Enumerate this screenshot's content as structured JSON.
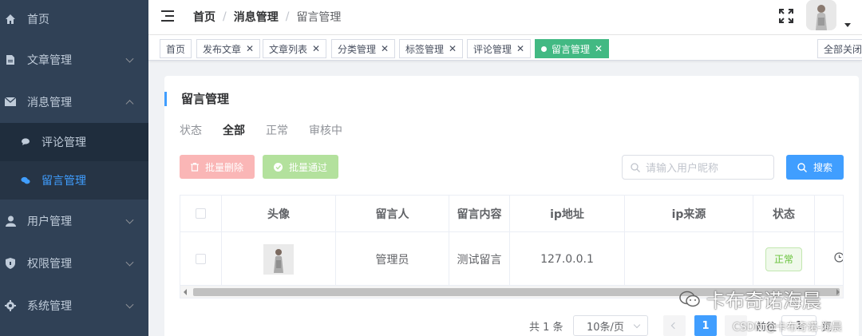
{
  "sidebar": {
    "items": [
      {
        "label": "首页",
        "icon": "home-icon"
      },
      {
        "label": "文章管理",
        "icon": "document-icon"
      },
      {
        "label": "消息管理",
        "icon": "mail-icon"
      },
      {
        "label": "评论管理",
        "icon": "comment-icon"
      },
      {
        "label": "留言管理",
        "icon": "chat-icon"
      },
      {
        "label": "用户管理",
        "icon": "user-icon"
      },
      {
        "label": "权限管理",
        "icon": "shield-icon"
      },
      {
        "label": "系统管理",
        "icon": "gear-icon"
      }
    ],
    "active_color": "#409eff",
    "bg_color": "#304156"
  },
  "header": {
    "breadcrumb": [
      "首页",
      "消息管理",
      "留言管理"
    ],
    "separator": "/"
  },
  "tags": {
    "items": [
      "首页",
      "发布文章",
      "文章列表",
      "分类管理",
      "标签管理",
      "评论管理",
      "留言管理"
    ],
    "active": "留言管理",
    "close_all": "全部关闭",
    "close_glyph": "✕",
    "active_color": "#42b983"
  },
  "page": {
    "title": "留言管理",
    "status_label": "状态",
    "status_options": [
      "全部",
      "正常",
      "审核中"
    ],
    "selected_status": "全部"
  },
  "toolbar": {
    "batch_delete": "批量删除",
    "batch_pass": "批量通过",
    "search_placeholder": "请输入用户昵称",
    "search_button": "搜索"
  },
  "table": {
    "columns": [
      "头像",
      "留言人",
      "留言内容",
      "ip地址",
      "ip来源",
      "状态"
    ],
    "rows": [
      {
        "avatar": "avatar-image",
        "author": "管理员",
        "content": "测试留言",
        "ip": "127.0.0.1",
        "source": "",
        "status": "正常"
      }
    ]
  },
  "pagination": {
    "total": "共 1 条",
    "page_size": "10条/页",
    "current": "1",
    "goto_prefix": "前往",
    "goto_value": "1",
    "goto_suffix": "页"
  },
  "watermark": {
    "main": "卡布奇诺海晨",
    "sub": "CSDN @卡布奇诺-海晨"
  }
}
